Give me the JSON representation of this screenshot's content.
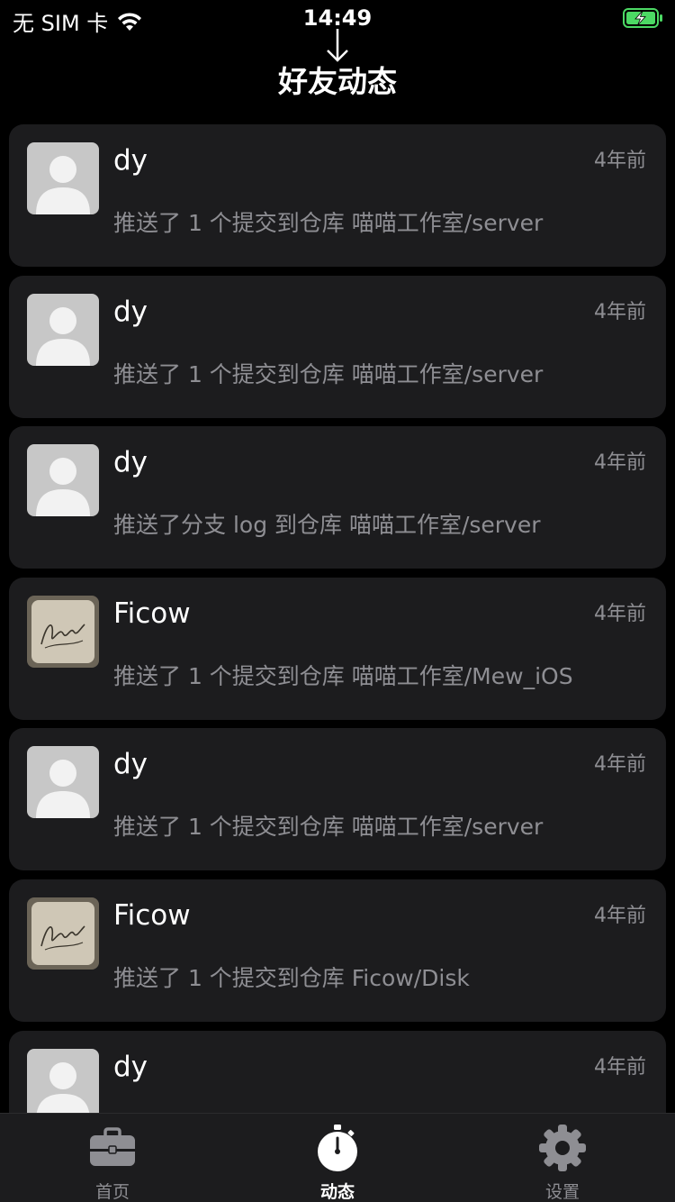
{
  "status_bar": {
    "carrier": "无 SIM 卡",
    "time": "14:49",
    "battery_color": "#4cd964"
  },
  "nav": {
    "title": "好友动态"
  },
  "feed": {
    "items": [
      {
        "user": "dy",
        "time": "4年前",
        "desc": "推送了 1 个提交到仓库 喵喵工作室/server",
        "avatar": "default-avatar"
      },
      {
        "user": "dy",
        "time": "4年前",
        "desc": "推送了 1 个提交到仓库 喵喵工作室/server",
        "avatar": "default-avatar"
      },
      {
        "user": "dy",
        "time": "4年前",
        "desc": "推送了分支 log 到仓库 喵喵工作室/server",
        "avatar": "default-avatar"
      },
      {
        "user": "Ficow",
        "time": "4年前",
        "desc": "推送了 1 个提交到仓库 喵喵工作室/Mew_iOS",
        "avatar": "signature-avatar"
      },
      {
        "user": "dy",
        "time": "4年前",
        "desc": "推送了 1 个提交到仓库 喵喵工作室/server",
        "avatar": "default-avatar"
      },
      {
        "user": "Ficow",
        "time": "4年前",
        "desc": "推送了 1 个提交到仓库 Ficow/Disk",
        "avatar": "signature-avatar"
      },
      {
        "user": "dy",
        "time": "4年前",
        "desc": "",
        "avatar": "default-avatar"
      }
    ]
  },
  "tabs": [
    {
      "label": "首页",
      "icon": "briefcase-icon",
      "active": false
    },
    {
      "label": "动态",
      "icon": "stopwatch-icon",
      "active": true
    },
    {
      "label": "设置",
      "icon": "gear-icon",
      "active": false
    }
  ],
  "colors": {
    "background": "#000000",
    "card": "#1c1c1e",
    "secondary_text": "#8e8e93",
    "tab_inactive": "#8e8e93",
    "tab_active": "#ffffff"
  }
}
